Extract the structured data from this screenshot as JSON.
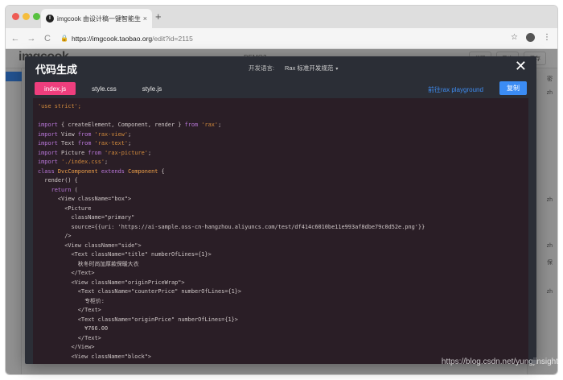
{
  "browser": {
    "tab_title": "imgcook 由设计稿一键智能生成",
    "tab_favicon": "i",
    "tab_close": "×",
    "new_tab": "+",
    "url_host": "https://imgcook.taobao.org",
    "url_path": "/edit?id=2115",
    "nav_back": "←",
    "nav_forward": "→",
    "nav_reload": "C",
    "lock": "🔒",
    "star": "☆",
    "menu": "⋮"
  },
  "app": {
    "logo": "imgcook",
    "demo_label": "DEMO2",
    "header_buttons": [
      "代码",
      "导出",
      "保存"
    ],
    "right_rows": [
      "密",
      "zh",
      "",
      "",
      "",
      "",
      "",
      "",
      "zh",
      "",
      "",
      "zh",
      "保",
      "",
      "zh",
      "",
      ""
    ]
  },
  "modal": {
    "title": "代码生成",
    "lang_label": "开发语言:",
    "lang_value": "Rax 标准开发规范",
    "lang_caret": "▾",
    "close": "✕",
    "file_tabs": [
      "index.js",
      "style.css",
      "style.js"
    ],
    "active_tab": 0,
    "playground_link": "前往rax playground",
    "copy_button": "复制"
  },
  "code_lines": [
    [
      [
        "str",
        "'use strict';"
      ]
    ],
    [],
    [
      [
        "kw",
        "import"
      ],
      [
        "plain",
        " { createElement, Component, render } "
      ],
      [
        "kw",
        "from"
      ],
      [
        "plain",
        " "
      ],
      [
        "str",
        "'rax'"
      ],
      [
        "plain",
        ";"
      ]
    ],
    [
      [
        "kw",
        "import"
      ],
      [
        "plain",
        " View "
      ],
      [
        "kw",
        "from"
      ],
      [
        "plain",
        " "
      ],
      [
        "str",
        "'rax-view'"
      ],
      [
        "plain",
        ";"
      ]
    ],
    [
      [
        "kw",
        "import"
      ],
      [
        "plain",
        " Text "
      ],
      [
        "kw",
        "from"
      ],
      [
        "plain",
        " "
      ],
      [
        "str",
        "'rax-text'"
      ],
      [
        "plain",
        ";"
      ]
    ],
    [
      [
        "kw",
        "import"
      ],
      [
        "plain",
        " Picture "
      ],
      [
        "kw",
        "from"
      ],
      [
        "plain",
        " "
      ],
      [
        "str",
        "'rax-picture'"
      ],
      [
        "plain",
        ";"
      ]
    ],
    [
      [
        "kw",
        "import"
      ],
      [
        "plain",
        " "
      ],
      [
        "str",
        "'./index.css'"
      ],
      [
        "plain",
        ";"
      ]
    ],
    [
      [
        "kw",
        "class"
      ],
      [
        "plain",
        " "
      ],
      [
        "cls",
        "DvcComponent"
      ],
      [
        "plain",
        " "
      ],
      [
        "kw",
        "extends"
      ],
      [
        "plain",
        " "
      ],
      [
        "cls",
        "Component"
      ],
      [
        "plain",
        " {"
      ]
    ],
    [
      [
        "plain",
        "  render() {"
      ]
    ],
    [
      [
        "plain",
        "    "
      ],
      [
        "kw",
        "return"
      ],
      [
        "plain",
        " ("
      ]
    ],
    [
      [
        "plain",
        "      <View className=\"box\">"
      ]
    ],
    [
      [
        "plain",
        "        <Picture"
      ]
    ],
    [
      [
        "plain",
        "          className=\"primary\""
      ]
    ],
    [
      [
        "plain",
        "          source={{uri: 'https://ai-sample.oss-cn-hangzhou.aliyuncs.com/test/df414c6010be11e993af8dbe79c0d52e.png'}}"
      ]
    ],
    [
      [
        "plain",
        "        />"
      ]
    ],
    [
      [
        "plain",
        "        <View className=\"side\">"
      ]
    ],
    [
      [
        "plain",
        "          <Text className=\"title\" numberOfLines={1}>"
      ]
    ],
    [
      [
        "plain",
        "            秋冬时尚加厚款保暖大衣"
      ]
    ],
    [
      [
        "plain",
        "          </Text>"
      ]
    ],
    [
      [
        "plain",
        "          <View className=\"originPriceWrap\">"
      ]
    ],
    [
      [
        "plain",
        "            <Text className=\"counterPrice\" numberOfLines={1}>"
      ]
    ],
    [
      [
        "plain",
        "              专柜价:"
      ]
    ],
    [
      [
        "plain",
        "            </Text>"
      ]
    ],
    [
      [
        "plain",
        "            <Text className=\"originPrice\" numberOfLines={1}>"
      ]
    ],
    [
      [
        "plain",
        "              ¥766.00"
      ]
    ],
    [
      [
        "plain",
        "            </Text>"
      ]
    ],
    [
      [
        "plain",
        "          </View>"
      ]
    ],
    [
      [
        "plain",
        "          <View className=\"block\">"
      ]
    ]
  ],
  "watermark": "https://blog.csdn.net/yungjinsight"
}
